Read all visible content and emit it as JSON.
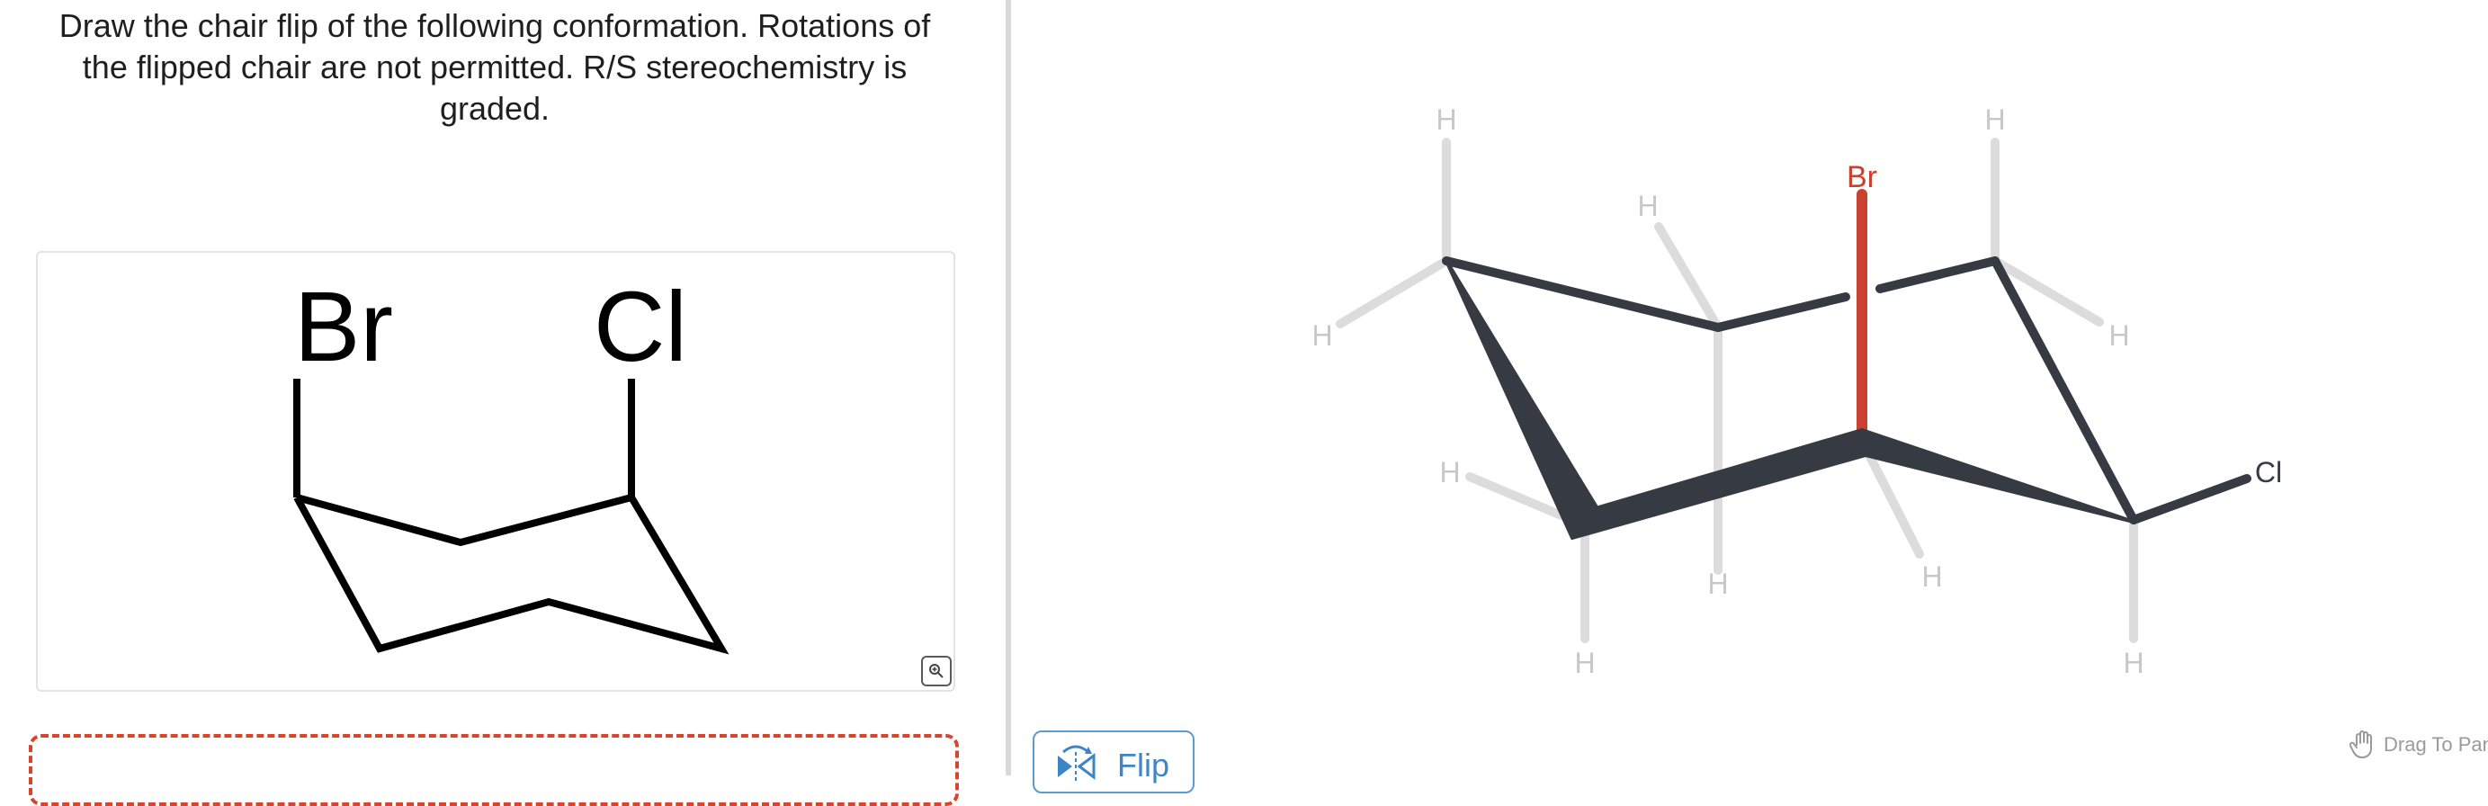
{
  "question": {
    "lines": [
      "Draw the chair flip of the following conformation. Rotations of",
      "the flipped chair are not permitted.  R/S stereochemistry is",
      "graded."
    ]
  },
  "given_molecule": {
    "substituent_left": "Br",
    "substituent_right": "Cl"
  },
  "zoom_button": {
    "icon": "zoom-in-icon"
  },
  "editor": {
    "atoms": {
      "br": "Br",
      "cl": "Cl",
      "h": "H"
    },
    "colors": {
      "bond": "#363a42",
      "hydrogen_bond": "#dcdcdc",
      "hydrogen_label": "#c8c8c8",
      "bromine": "#c9412f",
      "chlorine_label": "#363a42"
    }
  },
  "flip_button": {
    "label": "Flip",
    "icon": "flip-icon"
  },
  "drag_hint": {
    "label": "Drag To Pan",
    "icon": "hand-icon"
  },
  "colors": {
    "dropzone_border": "#d9442f",
    "flip_accent": "#3c86c8",
    "divider": "#d9d9d9"
  }
}
